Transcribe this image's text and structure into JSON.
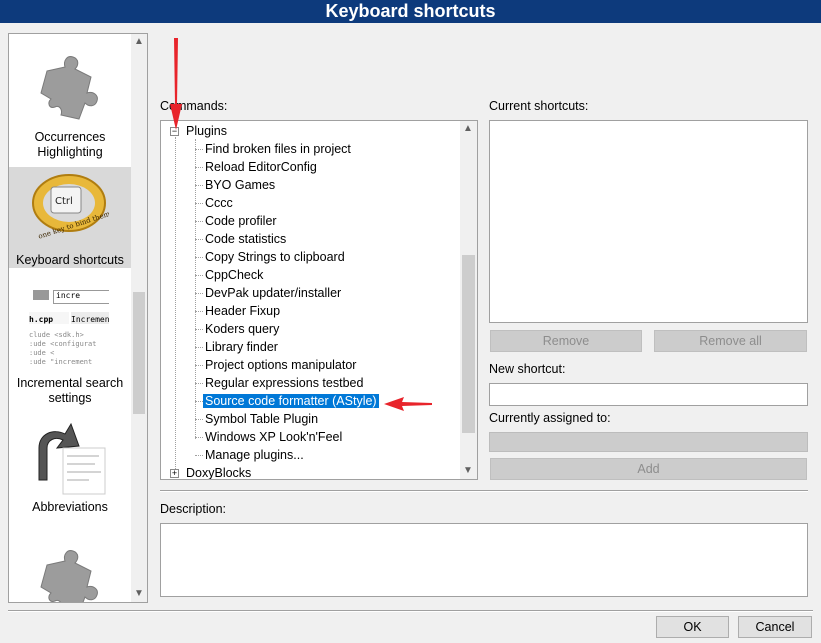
{
  "window": {
    "title": "Keyboard shortcuts"
  },
  "categories": [
    {
      "label": "Occurrences Highlighting",
      "icon": "puzzle-icon"
    },
    {
      "label": "Keyboard shortcuts",
      "icon": "keyboard-ring-icon",
      "ring_text": "Ctrl",
      "ring_motto": "one key to bind them",
      "selected": true
    },
    {
      "label": "Incremental search settings",
      "icon": "incremental-search-icon",
      "thumb_field": "incre",
      "thumb_tab": "h.cpp",
      "thumb_tab2": "Incremen",
      "thumb_lines": [
        "clude <sdk.h>",
        ":ude <configurat",
        ":ude <",
        ":ude \"increment"
      ]
    },
    {
      "label": "Abbreviations",
      "icon": "abbreviations-icon"
    },
    {
      "label": "",
      "icon": "puzzle-icon"
    }
  ],
  "commands": {
    "label": "Commands:",
    "root": "Plugins",
    "items": [
      "Find broken files in project",
      "Reload EditorConfig",
      "BYO Games",
      "Cccc",
      "Code profiler",
      "Code statistics",
      "Copy Strings to clipboard",
      "CppCheck",
      "DevPak updater/installer",
      "Header Fixup",
      "Koders query",
      "Library finder",
      "Project options manipulator",
      "Regular expressions testbed",
      "Source code formatter (AStyle)",
      "Symbol Table Plugin",
      "Windows XP Look'n'Feel",
      "Manage plugins..."
    ],
    "selected_index": 14,
    "next_root": "DoxyBlocks"
  },
  "current_shortcuts": {
    "label": "Current shortcuts:"
  },
  "buttons": {
    "remove": "Remove",
    "remove_all": "Remove all",
    "add": "Add",
    "ok": "OK",
    "cancel": "Cancel"
  },
  "new_shortcut": {
    "label": "New shortcut:",
    "value": ""
  },
  "assigned": {
    "label": "Currently assigned to:",
    "value": ""
  },
  "description": {
    "label": "Description:",
    "value": ""
  },
  "colors": {
    "title_bar": "#0d3a7c",
    "selection": "#0078d7",
    "annotation": "#e8242b"
  }
}
